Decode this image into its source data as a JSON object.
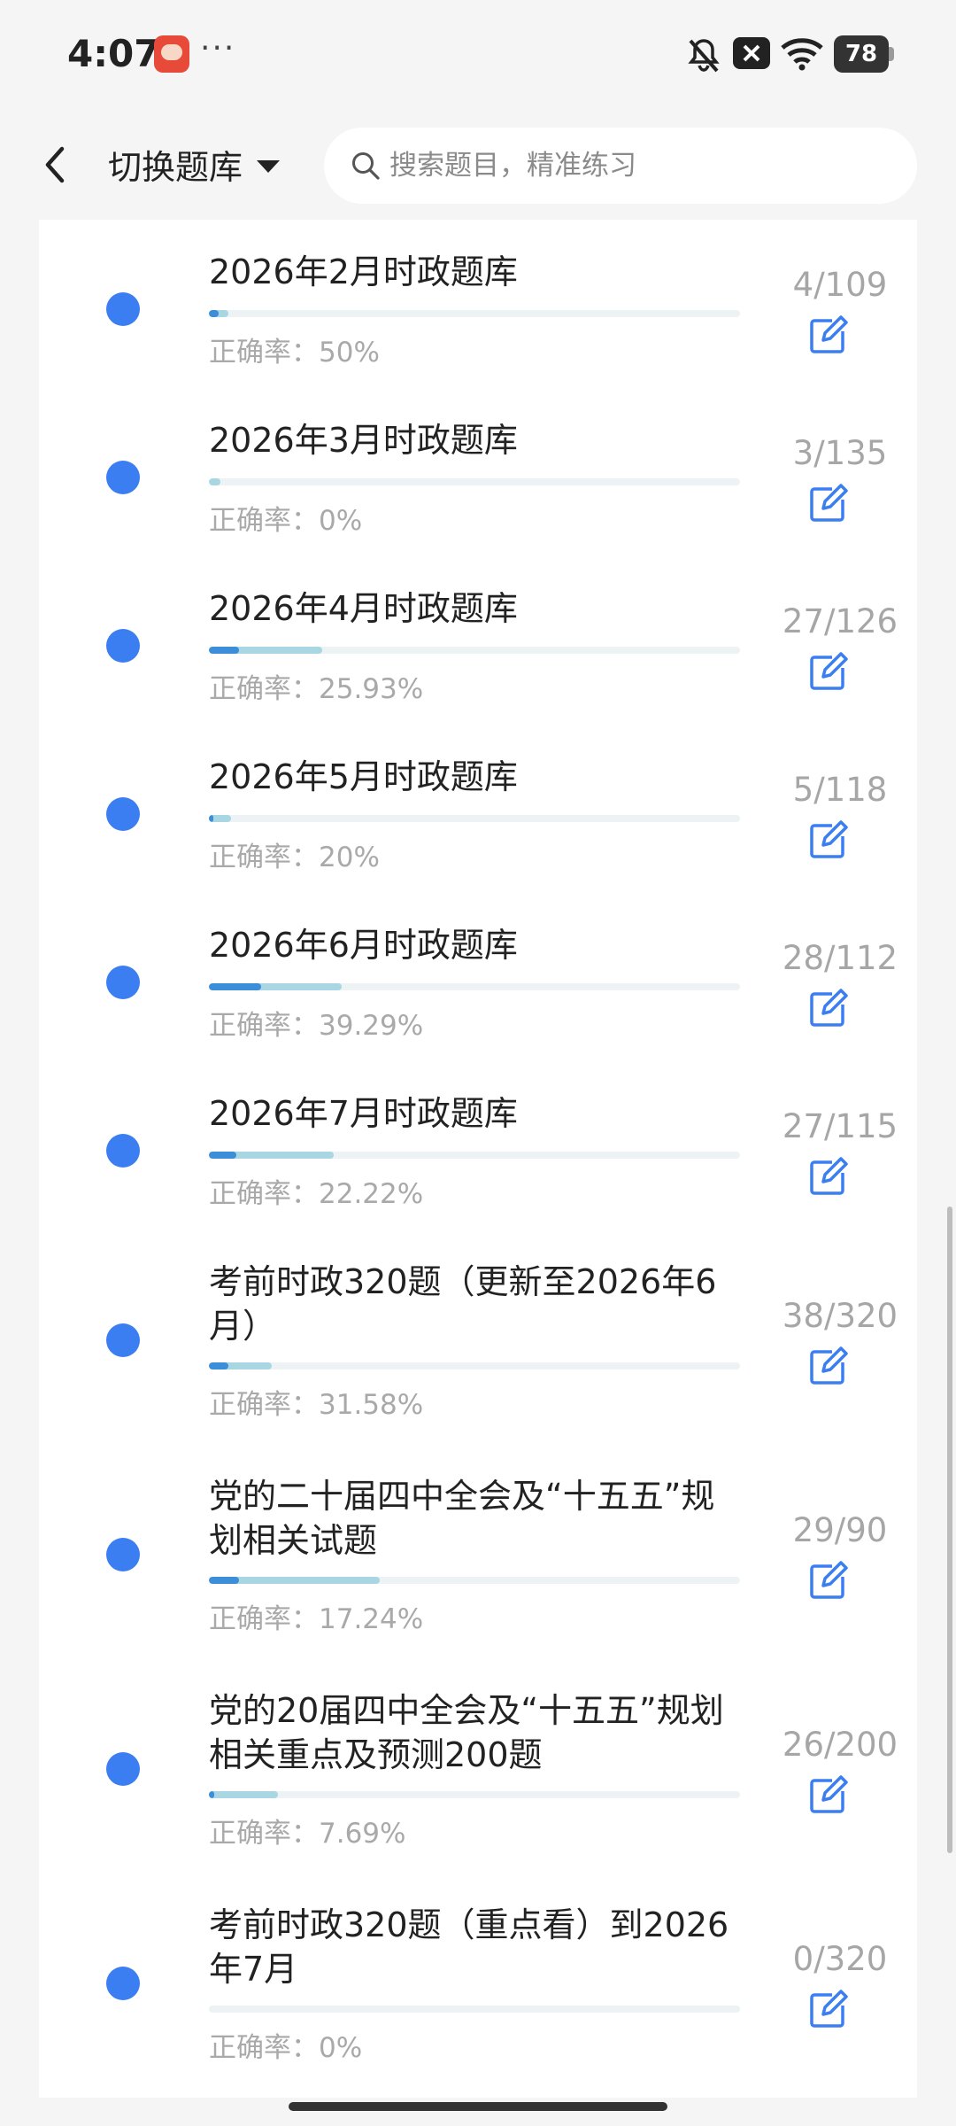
{
  "status": {
    "time": "4:07",
    "battery": "78"
  },
  "header": {
    "title": "切换题库",
    "search_placeholder": "搜索题目，精准练习"
  },
  "rate_label": "正确率：",
  "items": [
    {
      "title": "2026年2月时政题库",
      "rate": "正确率：50%",
      "count": "4/109",
      "progress_done": 0.037,
      "progress_correct": 0.018
    },
    {
      "title": "2026年3月时政题库",
      "rate": "正确率：0%",
      "count": "3/135",
      "progress_done": 0.022,
      "progress_correct": 0.0
    },
    {
      "title": "2026年4月时政题库",
      "rate": "正确率：25.93%",
      "count": "27/126",
      "progress_done": 0.214,
      "progress_correct": 0.056
    },
    {
      "title": "2026年5月时政题库",
      "rate": "正确率：20%",
      "count": "5/118",
      "progress_done": 0.042,
      "progress_correct": 0.008
    },
    {
      "title": "2026年6月时政题库",
      "rate": "正确率：39.29%",
      "count": "28/112",
      "progress_done": 0.25,
      "progress_correct": 0.098
    },
    {
      "title": "2026年7月时政题库",
      "rate": "正确率：22.22%",
      "count": "27/115",
      "progress_done": 0.235,
      "progress_correct": 0.052
    },
    {
      "title": "考前时政320题（更新至2026年6月）",
      "rate": "正确率：31.58%",
      "count": "38/320",
      "progress_done": 0.119,
      "progress_correct": 0.037
    },
    {
      "title": "党的二十届四中全会及“十五五”规划相关试题",
      "rate": "正确率：17.24%",
      "count": "29/90",
      "progress_done": 0.322,
      "progress_correct": 0.056
    },
    {
      "title": "党的20届四中全会及“十五五”规划相关重点及预测200题",
      "rate": "正确率：7.69%",
      "count": "26/200",
      "progress_done": 0.13,
      "progress_correct": 0.01
    },
    {
      "title": "考前时政320题（重点看）到2026年7月",
      "rate": "正确率：0%",
      "count": "0/320",
      "progress_done": 0.0,
      "progress_correct": 0.0
    }
  ]
}
